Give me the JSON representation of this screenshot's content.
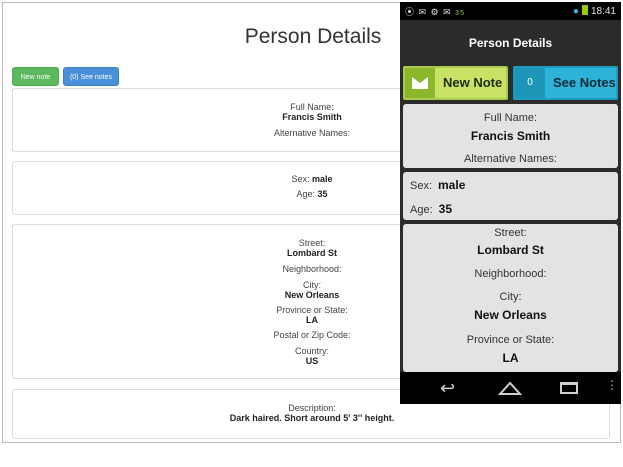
{
  "desktop": {
    "title": "Person Details",
    "new_note_label": "New note",
    "see_notes_count": "(0)",
    "see_notes_label": "See notes",
    "identity": {
      "full_name_label": "Full Name:",
      "full_name": "Francis Smith",
      "alt_names_label": "Alternative Names:"
    },
    "demographics": {
      "sex_label": "Sex:",
      "sex": "male",
      "age_label": "Age:",
      "age": "35"
    },
    "address": {
      "street_label": "Street:",
      "street": "Lombard St",
      "neighborhood_label": "Neighborhood:",
      "city_label": "City:",
      "city": "New Orleans",
      "province_label": "Province or State:",
      "province": "LA",
      "postal_label": "Postal or Zip Code:",
      "country_label": "Country:",
      "country": "US"
    },
    "description": {
      "label": "Description:",
      "text": "Dark haired. Short around 5' 3'' height."
    }
  },
  "phone": {
    "status": {
      "icons": "⦿ ✉ ⚙ ✉",
      "badge": "35",
      "time": "18:41"
    },
    "title": "Person Details",
    "new_note_label": "New Note",
    "notes_count": "0",
    "see_notes_label": "See Notes",
    "full_name_label": "Full Name:",
    "full_name": "Francis Smith",
    "alt_names_label": "Alternative Names:",
    "sex_label": "Sex:",
    "sex": "male",
    "age_label": "Age:",
    "age": "35",
    "street_label": "Street:",
    "street": "Lombard St",
    "neighborhood_label": "Neighborhood:",
    "city_label": "City:",
    "city": "New Orleans",
    "province_label": "Province or State:",
    "province": "LA"
  }
}
